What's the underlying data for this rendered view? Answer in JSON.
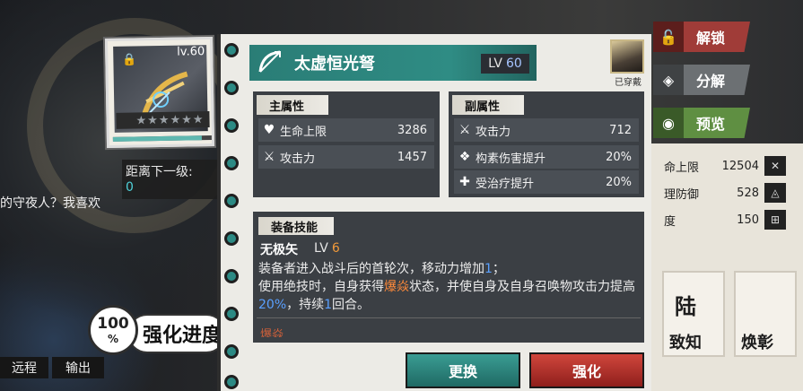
{
  "item": {
    "name": "太虚恒光弩",
    "level_label": "LV",
    "level": "60",
    "card_level": "lv.60",
    "stars_filled": 0,
    "stars_total": 6,
    "progress_fraction": 0.9
  },
  "next_level": {
    "label": "距离下一级:",
    "value": "0"
  },
  "wearer": {
    "label": "已穿戴"
  },
  "main_attr": {
    "title": "主属性",
    "rows": [
      {
        "name": "生命上限",
        "value": "3286",
        "icon": "heart-icon"
      },
      {
        "name": "攻击力",
        "value": "1457",
        "icon": "crossed-swords-icon"
      }
    ]
  },
  "sub_attr": {
    "title": "副属性",
    "rows": [
      {
        "name": "攻击力",
        "value": "712",
        "icon": "crossed-swords-icon"
      },
      {
        "name": "构素伤害提升",
        "value": "20%",
        "icon": "element-icon"
      },
      {
        "name": "受治疗提升",
        "value": "20%",
        "icon": "heal-icon"
      }
    ]
  },
  "skill": {
    "title": "装备技能",
    "name": "无极矢",
    "level_label": "LV",
    "level": "6",
    "desc_1a": "装备者进入战斗后的首轮次，移动力增加",
    "desc_1b": "1",
    "desc_1c": "；",
    "desc_2a": "使用绝技时，自身获得",
    "desc_2b": "爆焱",
    "desc_2c": "状态，并使自身及自身召唤物攻击力提高",
    "desc_2d": "20%",
    "desc_2e": "，持续",
    "desc_2f": "1",
    "desc_2g": "回合。",
    "tag": "爆焱"
  },
  "buttons": {
    "exchange": "更换",
    "enhance": "强化",
    "unlock": "解锁",
    "dismantle": "分解",
    "preview": "预览"
  },
  "progress_badge": {
    "percent": "100",
    "unit": "%",
    "label": "强化进度"
  },
  "background": {
    "dialog_text": "的守夜人？我喜欢",
    "right_stats": [
      {
        "label": "命上限",
        "value": "12504"
      },
      {
        "label": "理防御",
        "value": "528"
      },
      {
        "label": "度",
        "value": "150"
      }
    ],
    "bottom_tabs": [
      "远程",
      "输出"
    ],
    "tiles": [
      "致知",
      "焕彰"
    ],
    "tile_top": "陆"
  },
  "colors": {
    "teal": "#2f8c84",
    "red": "#a03c38",
    "green": "#5f8f42",
    "orange_highlight": "#ff8a3a",
    "blue_highlight": "#5aa0ff"
  }
}
